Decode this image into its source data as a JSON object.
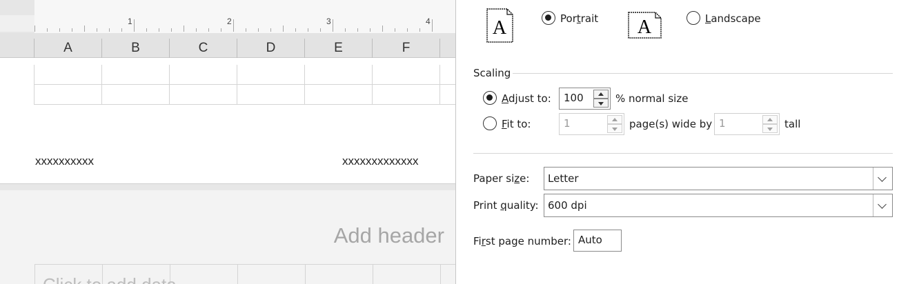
{
  "sheet": {
    "ruler_numbers": [
      "1",
      "2",
      "3",
      "4"
    ],
    "columns": [
      "A",
      "B",
      "C",
      "D",
      "E",
      "F"
    ],
    "cells": [
      "xxxxxxxxxx",
      "xxxxxxxxxxxxx"
    ],
    "add_header": "Add header",
    "click_to_add": "Click to add data"
  },
  "dialog": {
    "orientation": {
      "portrait_label": "Portrait",
      "portrait_underline": "t",
      "landscape_label": "Landscape",
      "landscape_underline": "L",
      "selected": "portrait",
      "icon_glyph": "A"
    },
    "scaling": {
      "title": "Scaling",
      "adjust_to_label": "Adjust to:",
      "adjust_to_value": "100",
      "adjust_to_suffix": "% normal size",
      "fit_to_label": "Fit to:",
      "fit_wide_value": "1",
      "fit_wide_suffix": "page(s) wide by",
      "fit_tall_value": "1",
      "fit_tall_suffix": "tall",
      "selected": "adjust"
    },
    "paper_size": {
      "label": "Paper size:",
      "value": "Letter"
    },
    "print_quality": {
      "label": "Print quality:",
      "value": "600 dpi"
    },
    "first_page_number": {
      "label": "First page number:",
      "value": "Auto"
    }
  }
}
